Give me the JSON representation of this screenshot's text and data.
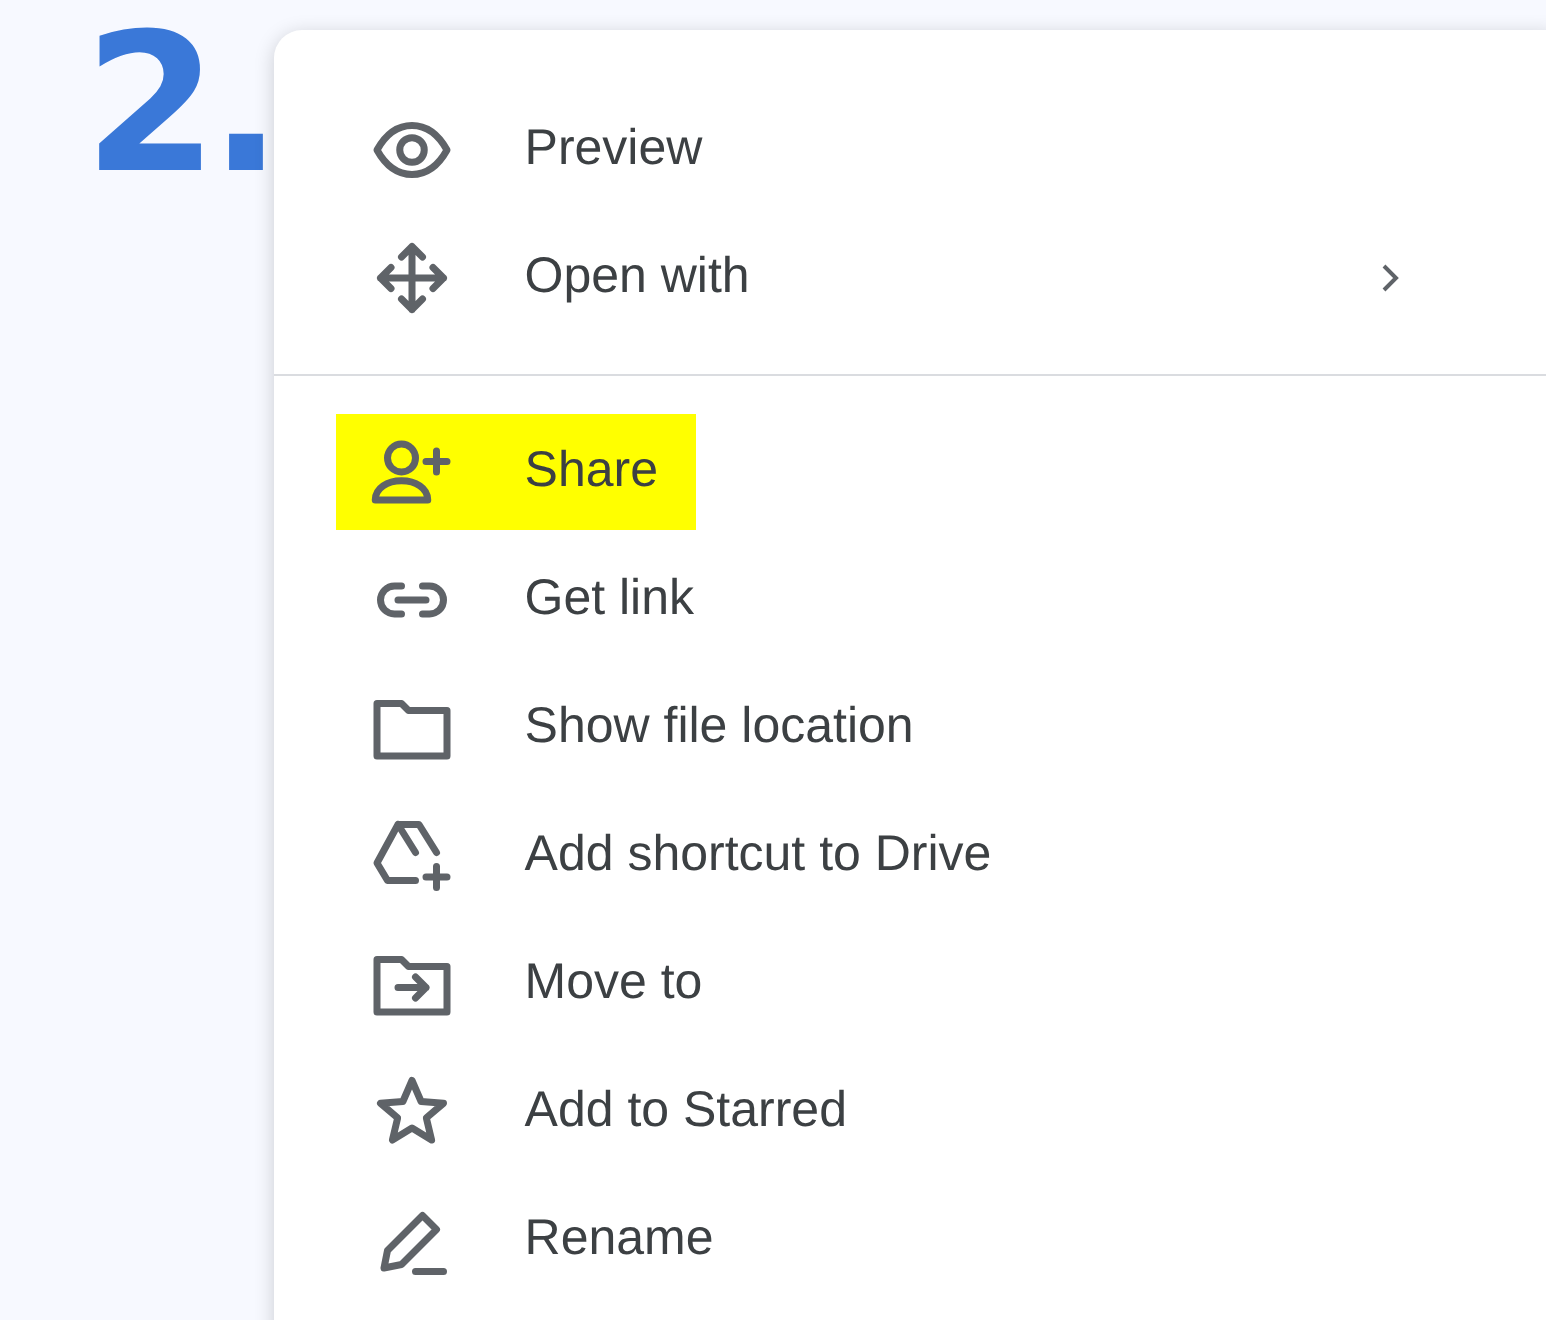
{
  "step_number": "2.",
  "menu": {
    "sections": [
      {
        "items": [
          {
            "label": "Preview",
            "highlighted": false,
            "has_submenu": false
          },
          {
            "label": "Open with",
            "highlighted": false,
            "has_submenu": true
          }
        ]
      },
      {
        "items": [
          {
            "label": "Share",
            "highlighted": true,
            "has_submenu": false
          },
          {
            "label": "Get link",
            "highlighted": false,
            "has_submenu": false
          },
          {
            "label": "Show file location",
            "highlighted": false,
            "has_submenu": false
          },
          {
            "label": "Add shortcut to Drive",
            "highlighted": false,
            "has_submenu": false
          },
          {
            "label": "Move to",
            "highlighted": false,
            "has_submenu": false
          },
          {
            "label": "Add to Starred",
            "highlighted": false,
            "has_submenu": false
          },
          {
            "label": "Rename",
            "highlighted": false,
            "has_submenu": false
          }
        ]
      }
    ]
  }
}
